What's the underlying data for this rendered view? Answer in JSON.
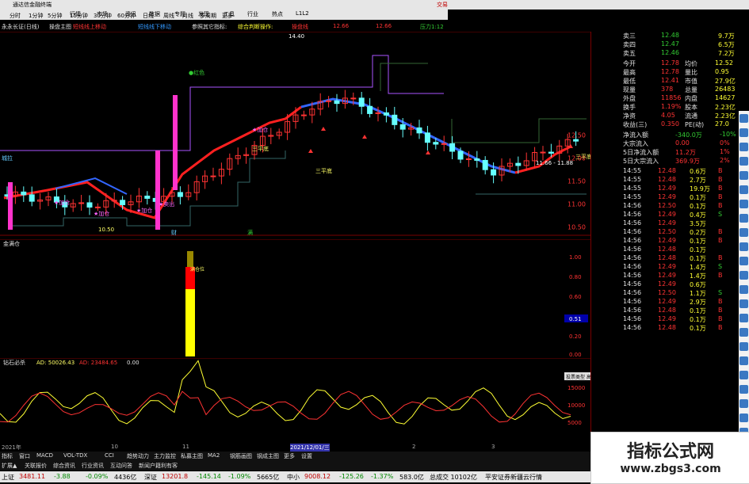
{
  "window": {
    "title": "通达信金融终端",
    "trade_label": "交易"
  },
  "menu": [
    "行情",
    "市场",
    "资讯",
    "数据",
    "专题",
    "发现",
    "工具",
    "行业",
    "热点",
    "L1L2"
  ],
  "periods": [
    "分时",
    "1分钟",
    "5分钟",
    "15分钟",
    "30分钟",
    "60分钟",
    "日线",
    "周线",
    "月线",
    "多周期",
    "更多"
  ],
  "indicator_bar": {
    "stock": "永永长证(日线)",
    "items": [
      {
        "label": "操盘主图",
        "color": "#e0e0e0"
      },
      {
        "label": "短线线上移动",
        "color": "#ff3333"
      },
      {
        "label": "短线线下移动",
        "color": "#3399ff"
      },
      {
        "label": "参照其它指标:",
        "color": "#e0e0e0"
      },
      {
        "label": "综合判断操作:",
        "color": "#ffff33"
      },
      {
        "label": "操盘线",
        "color": "#ff3333"
      },
      {
        "label": "12.66",
        "color": "#ff3333"
      },
      {
        "label": "12.66",
        "color": "#ff3333"
      },
      {
        "label": "压力1:12",
        "color": "#33cc33"
      }
    ]
  },
  "price_axis": [
    "12.50",
    "12.00",
    "11.50",
    "11.00",
    "10.50"
  ],
  "price_annotations": {
    "high": "14.40",
    "mid_range": "11.66 - 11.88",
    "low_tag": "10.50"
  },
  "chart_labels": {
    "add_positions": [
      "加仓",
      "加仓",
      "加仓",
      "加仓"
    ],
    "sell": [
      "卖出"
    ],
    "three_low": [
      "三平底",
      "三平底",
      "三平底"
    ],
    "buy_tag": "财",
    "buy_tag2": "满",
    "dot_label": "红色",
    "left_tag": "城拉"
  },
  "vol_panel": {
    "title": "金满仓",
    "axis": [
      "1.00",
      "0.80",
      "0.60",
      "0.40",
      "0.20",
      "0.00"
    ],
    "marker": "0.51",
    "bar_label": "满仓位"
  },
  "osc_panel": {
    "title": "钻石必杀",
    "ad_label": "AD: 50026.43",
    "ad2_label": "AD: 23484.65",
    "val": "0.00",
    "axis": [
      "15000",
      "10000",
      "5000"
    ],
    "popup": "投票类型 高级模式"
  },
  "time_axis": [
    "2021年",
    "10",
    "11",
    "2021/12/01/三",
    "2",
    "3"
  ],
  "tabs": [
    "指标",
    "窗口",
    "MACD",
    "VOL-TDX",
    "CCI",
    "趋势动力",
    "主力监控",
    "私募主图",
    "MA2",
    "钢筋画图",
    "钢成主图",
    "更多",
    "设置"
  ],
  "tabs2": [
    "扩展▲",
    "关联报价",
    "综合资讯",
    "行业资讯",
    "互动问答",
    "新闻户籍利有客"
  ],
  "quote": {
    "asks": [
      {
        "label": "卖三",
        "price": "12.48",
        "vol": "9.7万"
      },
      {
        "label": "卖四",
        "price": "12.47",
        "vol": "6.5万"
      },
      {
        "label": "卖五",
        "price": "12.46",
        "vol": "7.2万"
      }
    ],
    "rows": [
      {
        "l1": "今开",
        "v1": "12.78",
        "l2": "均价",
        "v2": "12.52"
      },
      {
        "l1": "最高",
        "v1": "12.78",
        "l2": "量比",
        "v2": "0.95"
      },
      {
        "l1": "最低",
        "v1": "12.41",
        "l2": "市值",
        "v2": "27.9亿"
      },
      {
        "l1": "现量",
        "v1": "378",
        "l2": "总量",
        "v2": "26483"
      },
      {
        "l1": "外盘",
        "v1": "11856",
        "l2": "内盘",
        "v2": "14627"
      },
      {
        "l1": "换手",
        "v1": "1.19%",
        "l2": "股本",
        "v2": "2.23亿"
      },
      {
        "l1": "净资",
        "v1": "4.05",
        "l2": "流通",
        "v2": "2.23亿"
      },
      {
        "l1": "收益(三)",
        "v1": "0.350",
        "l2": "PE(动)",
        "v2": "27.0"
      }
    ],
    "flows": [
      {
        "label": "净流入额",
        "v": "-340.0万",
        "p": "-10%"
      },
      {
        "label": "大宗流入",
        "v": "0.00",
        "p": "0%"
      },
      {
        "label": "5日净流入额",
        "v": "11.2万",
        "p": "1%"
      },
      {
        "label": "5日大宗流入",
        "v": "369.9万",
        "p": "2%"
      }
    ],
    "ticks": [
      {
        "t": "14:55",
        "p": "12.48",
        "v": "0.6万",
        "s": "B"
      },
      {
        "t": "14:55",
        "p": "12.48",
        "v": "2.7万",
        "s": "B"
      },
      {
        "t": "14:55",
        "p": "12.49",
        "v": "19.9万",
        "s": "B"
      },
      {
        "t": "14:55",
        "p": "12.49",
        "v": "0.1万",
        "s": "B"
      },
      {
        "t": "14:56",
        "p": "12.50",
        "v": "0.1万",
        "s": "B"
      },
      {
        "t": "14:56",
        "p": "12.49",
        "v": "0.4万",
        "s": "S"
      },
      {
        "t": "14:56",
        "p": "12.49",
        "v": "3.5万",
        "s": ""
      },
      {
        "t": "14:56",
        "p": "12.50",
        "v": "0.2万",
        "s": "B"
      },
      {
        "t": "14:56",
        "p": "12.49",
        "v": "0.1万",
        "s": "B"
      },
      {
        "t": "14:56",
        "p": "12.48",
        "v": "0.1万",
        "s": ""
      },
      {
        "t": "14:56",
        "p": "12.48",
        "v": "0.1万",
        "s": "B"
      },
      {
        "t": "14:56",
        "p": "12.49",
        "v": "1.4万",
        "s": "S"
      },
      {
        "t": "14:56",
        "p": "12.49",
        "v": "1.4万",
        "s": "B"
      },
      {
        "t": "14:56",
        "p": "12.49",
        "v": "0.6万",
        "s": ""
      },
      {
        "t": "14:56",
        "p": "12.50",
        "v": "1.1万",
        "s": "S"
      },
      {
        "t": "14:56",
        "p": "12.49",
        "v": "2.9万",
        "s": "B"
      },
      {
        "t": "14:56",
        "p": "12.48",
        "v": "0.1万",
        "s": "B"
      },
      {
        "t": "14:56",
        "p": "12.49",
        "v": "0.1万",
        "s": "B"
      },
      {
        "t": "14:56",
        "p": "12.48",
        "v": "0.1万",
        "s": "B"
      }
    ]
  },
  "status": {
    "sh": {
      "label": "上证",
      "v": "3481.11",
      "c": "-3.88",
      "p": "-0.09%",
      "a": "4436亿"
    },
    "sz": {
      "label": "深证",
      "v": "13201.8",
      "c": "-145.14",
      "p": "-1.09%",
      "a": "5665亿"
    },
    "zx": {
      "label": "中小",
      "v": "9008.12",
      "c": "-125.26",
      "p": "-1.37%",
      "a": "583.0亿"
    },
    "total": "总成交 10102亿",
    "broker": "平安证券新疆云行情"
  },
  "watermark": {
    "title": "指标公式网",
    "url": "www.zbgs3.com"
  },
  "colors": {
    "up": "#ff3333",
    "down": "#33cc33",
    "bg": "#000000",
    "ma_red": "#ff2020",
    "ma_blue": "#3366ff",
    "bull": "#ff3333",
    "bear": "#66ffff"
  }
}
